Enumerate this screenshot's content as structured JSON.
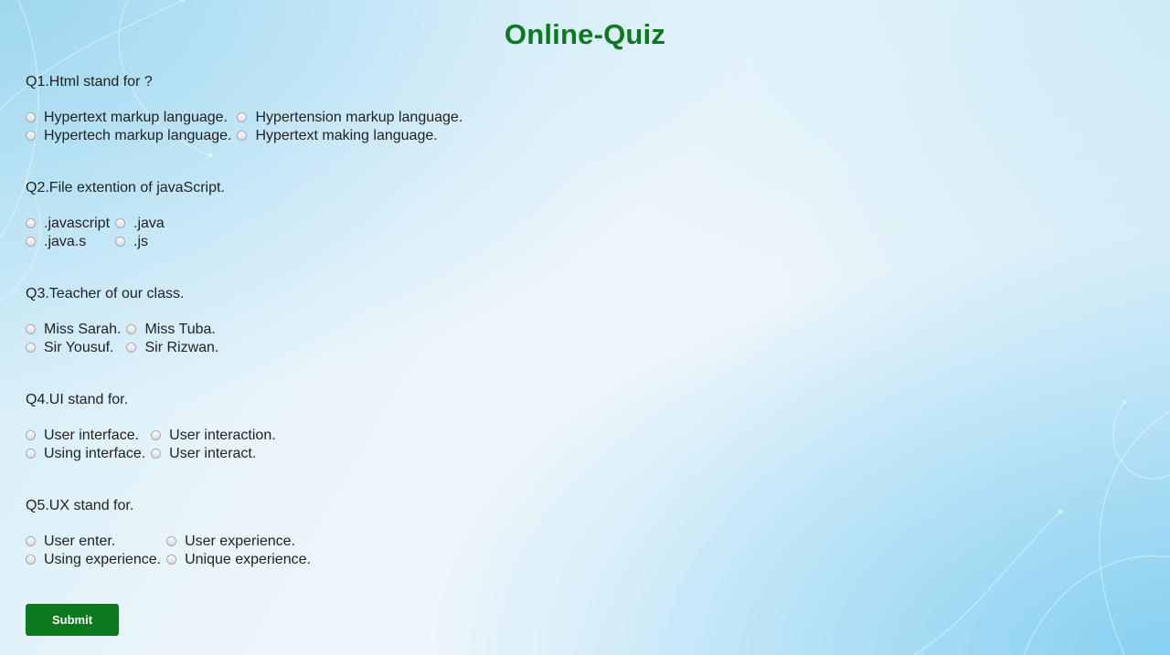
{
  "title": "Online-Quiz",
  "questions": [
    {
      "text": "Q1.Html stand for ?",
      "options": [
        "Hypertext markup language.",
        "Hypertension markup language.",
        "Hypertech markup language.",
        "Hypertext making language."
      ]
    },
    {
      "text": "Q2.File extention of javaScript.",
      "options": [
        ".javascript",
        ".java",
        ".java.s",
        ".js"
      ]
    },
    {
      "text": "Q3.Teacher of our class.",
      "options": [
        "Miss Sarah.",
        "Miss Tuba.",
        "Sir Yousuf.",
        "Sir Rizwan."
      ]
    },
    {
      "text": "Q4.UI stand for.",
      "options": [
        "User interface.",
        "User interaction.",
        "Using interface.",
        "User interact."
      ]
    },
    {
      "text": "Q5.UX stand for.",
      "options": [
        "User enter.",
        "User experience.",
        "Using experience.",
        "Unique experience."
      ]
    }
  ],
  "submit_label": "Submit",
  "colors": {
    "title": "#0b7a1c",
    "submit_bg": "#0b7a1c",
    "text": "#222222"
  }
}
